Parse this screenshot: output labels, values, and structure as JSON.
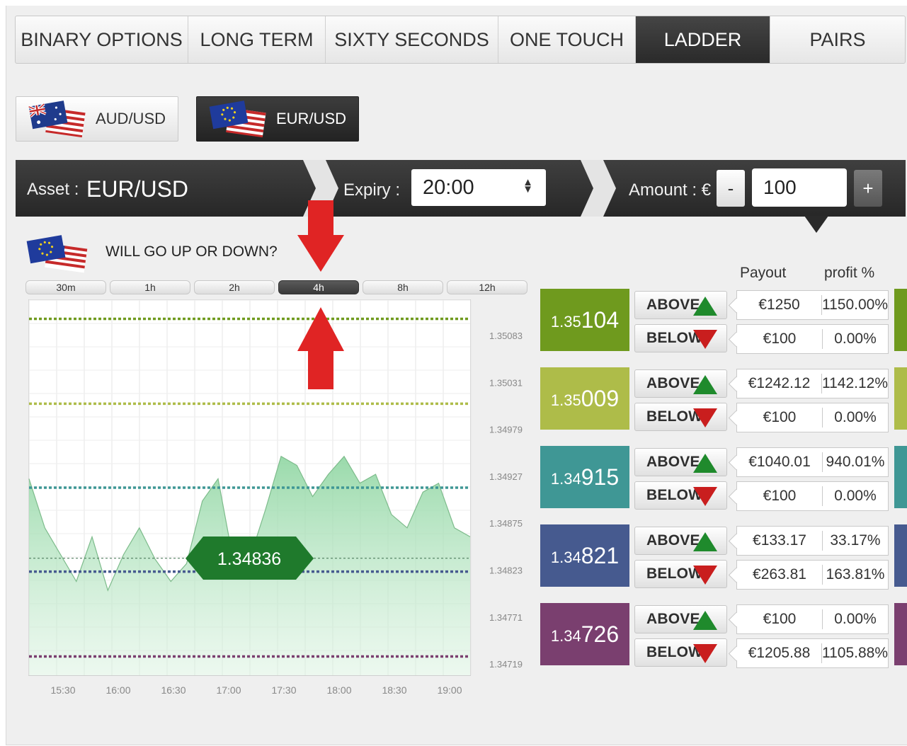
{
  "tabs": [
    {
      "label": "BINARY OPTIONS",
      "active": false
    },
    {
      "label": "LONG TERM",
      "active": false
    },
    {
      "label": "SIXTY SECONDS",
      "active": false
    },
    {
      "label": "ONE TOUCH",
      "active": false
    },
    {
      "label": "LADDER",
      "active": true
    },
    {
      "label": "PAIRS",
      "active": false
    }
  ],
  "assets": [
    {
      "label": "AUD/USD",
      "selected": false
    },
    {
      "label": "EUR/USD",
      "selected": true
    }
  ],
  "trade_bar": {
    "asset_label": "Asset :",
    "asset_value": "EUR/USD",
    "expiry_label": "Expiry :",
    "expiry_value": "20:00",
    "amount_label": "Amount : €",
    "minus_label": "-",
    "amount_value": "100",
    "plus_label": "+"
  },
  "question": "WILL GO UP OR DOWN?",
  "timeframes": [
    "30m",
    "1h",
    "2h",
    "4h",
    "8h",
    "12h"
  ],
  "active_timeframe": "4h",
  "chart": {
    "y_ticks": [
      "1.35083",
      "1.35031",
      "1.34979",
      "1.34927",
      "1.34875",
      "1.34823",
      "1.34771",
      "1.34719"
    ],
    "x_ticks": [
      "15:30",
      "16:00",
      "16:30",
      "17:00",
      "17:30",
      "18:00",
      "18:30",
      "19:00"
    ],
    "current_price": "1.34836"
  },
  "chart_data": {
    "type": "area",
    "x_labels": [
      "15:30",
      "16:00",
      "16:30",
      "17:00",
      "17:30",
      "18:00",
      "18:30",
      "19:00"
    ],
    "ylim": [
      1.34705,
      1.35125
    ],
    "current_price": 1.34836,
    "ladder_levels": [
      1.35104,
      1.35009,
      1.34915,
      1.34821,
      1.34726
    ],
    "series": [
      {
        "values": [
          1.34925,
          1.3487,
          1.3484,
          1.3481,
          1.3486,
          1.348,
          1.3484,
          1.3487,
          1.34835,
          1.3481,
          1.3483,
          1.349,
          1.34925,
          1.3483,
          1.34835,
          1.3489,
          1.3495,
          1.3494,
          1.34905,
          1.3493,
          1.3495,
          1.3492,
          1.3493,
          1.34885,
          1.3487,
          1.3491,
          1.3492,
          1.3487,
          1.3486
        ]
      }
    ]
  },
  "ladder": {
    "payout_header": "Payout",
    "profit_header": "profit %",
    "above_label": "ABOVE",
    "below_label": "BELOW",
    "rows": [
      {
        "price_prefix": "1.35",
        "price_suffix": "104",
        "color": "#6f9a1e",
        "above_payout": "€1250",
        "above_profit": "1150.00%",
        "below_payout": "€100",
        "below_profit": "0.00%"
      },
      {
        "price_prefix": "1.35",
        "price_suffix": "009",
        "color": "#aebc49",
        "above_payout": "€1242.12",
        "above_profit": "1142.12%",
        "below_payout": "€100",
        "below_profit": "0.00%"
      },
      {
        "price_prefix": "1.34",
        "price_suffix": "915",
        "color": "#3f9795",
        "above_payout": "€1040.01",
        "above_profit": "940.01%",
        "below_payout": "€100",
        "below_profit": "0.00%"
      },
      {
        "price_prefix": "1.34",
        "price_suffix": "821",
        "color": "#465a8f",
        "above_payout": "€133.17",
        "above_profit": "33.17%",
        "below_payout": "€263.81",
        "below_profit": "163.81%"
      },
      {
        "price_prefix": "1.34",
        "price_suffix": "726",
        "color": "#7a3f6f",
        "above_payout": "€100",
        "above_profit": "0.00%",
        "below_payout": "€1205.88",
        "below_profit": "1105.88%"
      }
    ]
  }
}
